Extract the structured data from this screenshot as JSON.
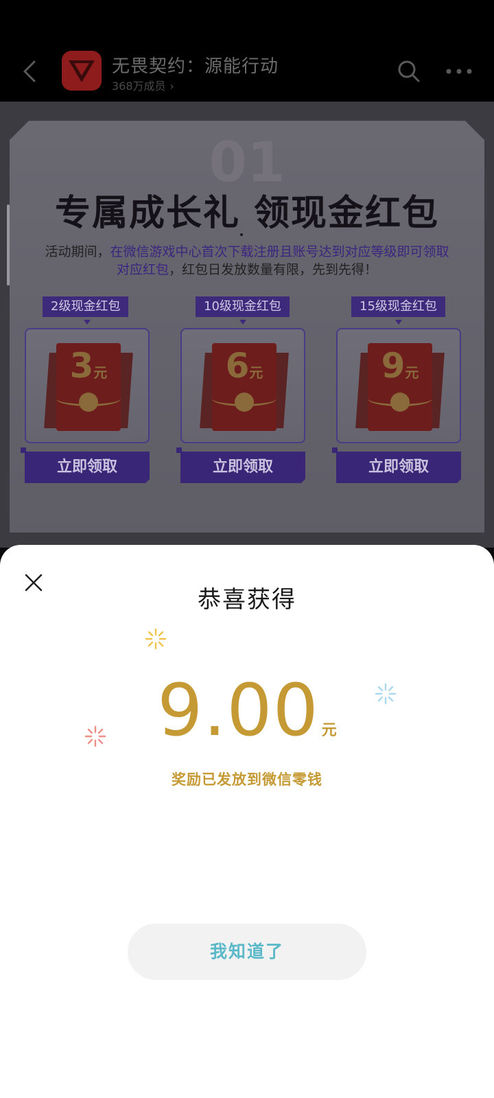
{
  "topbar": {
    "title": "无畏契约：源能行动",
    "members": "368万成员"
  },
  "promo": {
    "deco_number": "01",
    "title": "专属成长礼 领现金红包",
    "desc_prefix": "活动期间，",
    "desc_highlight": "在微信游戏中心首次下载注册且账号达到对应等级即可领取对应红包",
    "desc_suffix": "，红包日发放数量有限，先到先得！",
    "rewards": [
      {
        "tag": "2级现金红包",
        "amount": "3",
        "unit": "元",
        "button": "立即领取"
      },
      {
        "tag": "10级现金红包",
        "amount": "6",
        "unit": "元",
        "button": "立即领取"
      },
      {
        "tag": "15级现金红包",
        "amount": "9",
        "unit": "元",
        "button": "立即领取"
      }
    ]
  },
  "modal": {
    "title": "恭喜获得",
    "amount": "9.00",
    "unit": "元",
    "note": "奖励已发放到微信零钱",
    "ok_button": "我知道了"
  },
  "colors": {
    "gold": "#c59a35",
    "ok_text": "#5bb8c9",
    "purple": "#3a2676"
  }
}
